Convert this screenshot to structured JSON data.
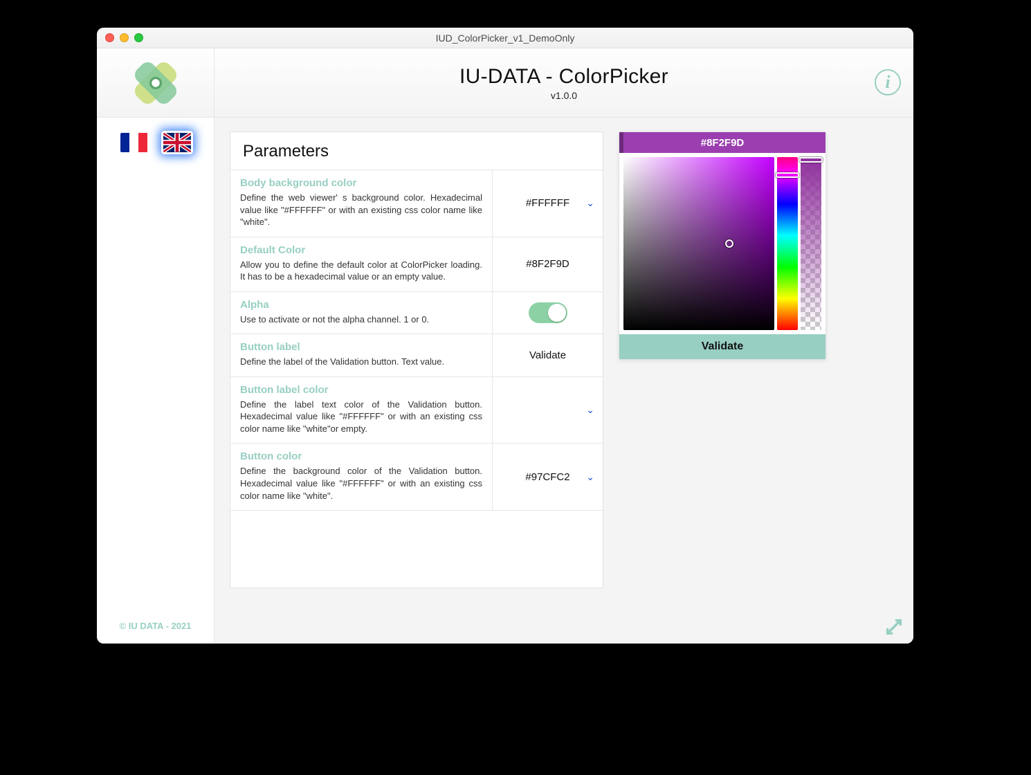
{
  "window": {
    "title": "IUD_ColorPicker_v1_DemoOnly"
  },
  "header": {
    "title": "IU-DATA - ColorPicker",
    "version": "v1.0.0"
  },
  "sidebar": {
    "languages": [
      "fr",
      "en"
    ],
    "selected_language": "en",
    "copyright": "© IU DATA - 2021"
  },
  "params": {
    "heading": "Parameters",
    "rows": [
      {
        "title": "Body background color",
        "desc": "Define the web viewer' s background color. Hexadecimal value like \"#FFFFFF\" or with an existing css color name like \"white\".",
        "value": "#FFFFFF",
        "kind": "dropdown"
      },
      {
        "title": "Default Color",
        "desc": "Allow you to define the default color at ColorPicker loading. It has to be a hexadecimal value or an empty value.",
        "value": "#8F2F9D",
        "kind": "text"
      },
      {
        "title": "Alpha",
        "desc": "Use to activate or not the alpha channel. 1 or 0.",
        "value": "on",
        "kind": "toggle"
      },
      {
        "title": "Button label",
        "desc": "Define the label of the Validation button. Text value.",
        "value": "Validate",
        "kind": "text"
      },
      {
        "title": "Button label color",
        "desc": "Define the label text color of the Validation button. Hexadecimal value like \"#FFFFFF\" or with an existing css color name like \"white\"or empty.",
        "value": "",
        "kind": "dropdown"
      },
      {
        "title": "Button color",
        "desc": "Define the background color of the Validation button. Hexadecimal value like \"#FFFFFF\" or with an existing css color name like \"white\".",
        "value": "#97CFC2",
        "kind": "dropdown"
      }
    ]
  },
  "picker": {
    "current_hex": "#8F2F9D",
    "validate_label": "Validate",
    "validate_bg": "#97CFC2"
  },
  "colors": {
    "accent": "#97CFC2"
  }
}
